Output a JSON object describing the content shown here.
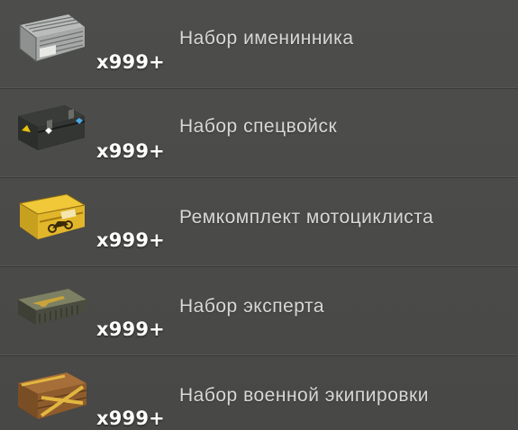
{
  "items": [
    {
      "name": "Набор именинника",
      "quantity": "x999+",
      "icon": "silver-crate-icon"
    },
    {
      "name": "Набор спецвойск",
      "quantity": "x999+",
      "icon": "black-case-icon"
    },
    {
      "name": "Ремкомплект мотоциклиста",
      "quantity": "x999+",
      "icon": "yellow-motorcycle-box-icon"
    },
    {
      "name": "Набор эксперта",
      "quantity": "x999+",
      "icon": "rifle-case-icon"
    },
    {
      "name": "Набор военной экипировки",
      "quantity": "x999+",
      "icon": "wooden-crate-icon"
    }
  ]
}
